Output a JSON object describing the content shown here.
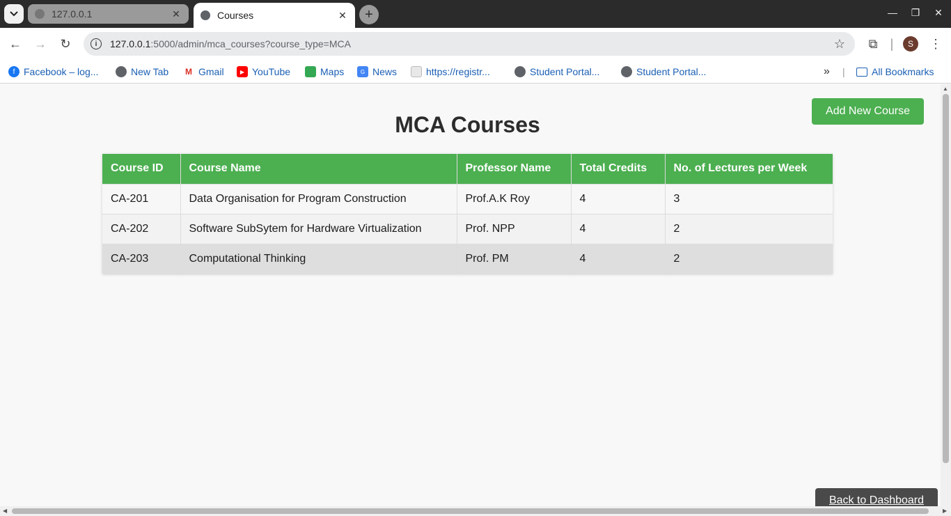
{
  "browser": {
    "tabs": [
      {
        "title": "127.0.0.1",
        "active": false
      },
      {
        "title": "Courses",
        "active": true
      }
    ],
    "url_host": "127.0.0.1",
    "url_rest": ":5000/admin/mca_courses?course_type=MCA",
    "profile_initial": "S",
    "bookmarks": [
      {
        "label": "Facebook – log...",
        "icon": "facebook-icon"
      },
      {
        "label": "New Tab",
        "icon": "globe-icon"
      },
      {
        "label": "Gmail",
        "icon": "gmail-icon"
      },
      {
        "label": "YouTube",
        "icon": "youtube-icon"
      },
      {
        "label": "Maps",
        "icon": "maps-icon"
      },
      {
        "label": "News",
        "icon": "news-icon"
      },
      {
        "label": "https://registr...",
        "icon": "page-icon"
      },
      {
        "label": "Student Portal...",
        "icon": "globe-icon"
      },
      {
        "label": "Student Portal...",
        "icon": "globe-icon"
      }
    ],
    "all_bookmarks_label": "All Bookmarks"
  },
  "page": {
    "title": "MCA Courses",
    "add_button_label": "Add New Course",
    "back_button_label": "Back to Dashboard",
    "table": {
      "headers": [
        "Course ID",
        "Course Name",
        "Professor Name",
        "Total Credits",
        "No. of Lectures per Week"
      ],
      "rows": [
        [
          "CA-201",
          "Data Organisation for Program Construction",
          "Prof.A.K Roy",
          "4",
          "3"
        ],
        [
          "CA-202",
          "Software SubSytem for Hardware Virtualization",
          "Prof. NPP",
          "4",
          "2"
        ],
        [
          "CA-203",
          "Computational Thinking",
          "Prof. PM",
          "4",
          "2"
        ]
      ]
    }
  },
  "colors": {
    "accent": "#4caf50",
    "back_button": "#4a4a4a"
  }
}
